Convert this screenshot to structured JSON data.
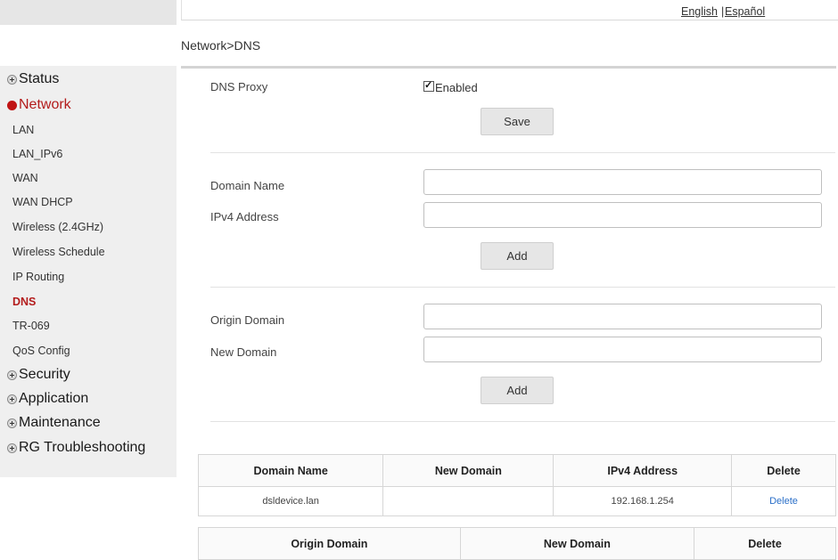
{
  "header": {
    "lang_english": "English",
    "lang_separator": "|",
    "lang_espanol": "Español",
    "breadcrumb": "Network>DNS"
  },
  "sidebar": {
    "sections": [
      {
        "label": "Status",
        "icon": "plus-circle-icon"
      },
      {
        "label": "Network",
        "icon": "red-dot-icon",
        "active": true
      },
      {
        "label": "Security",
        "icon": "plus-circle-icon"
      },
      {
        "label": "Application",
        "icon": "plus-circle-icon"
      },
      {
        "label": "Maintenance",
        "icon": "plus-circle-icon"
      },
      {
        "label": "RG Troubleshooting",
        "icon": "plus-circle-icon"
      }
    ],
    "network_items": [
      {
        "label": "LAN"
      },
      {
        "label": "LAN_IPv6"
      },
      {
        "label": "WAN"
      },
      {
        "label": "WAN DHCP"
      },
      {
        "label": "Wireless (2.4GHz)"
      },
      {
        "label": "Wireless Schedule"
      },
      {
        "label": "IP Routing"
      },
      {
        "label": "DNS",
        "active": true
      },
      {
        "label": "TR-069"
      },
      {
        "label": "QoS Config"
      }
    ]
  },
  "dns_proxy": {
    "label": "DNS Proxy",
    "checkbox_label": "Enabled",
    "checked": true,
    "save_label": "Save"
  },
  "host_form": {
    "domain_name_label": "Domain Name",
    "domain_name_value": "",
    "ipv4_label": "IPv4 Address",
    "ipv4_value": "",
    "add_label": "Add"
  },
  "rewrite_form": {
    "origin_domain_label": "Origin Domain",
    "origin_domain_value": "",
    "new_domain_label": "New Domain",
    "new_domain_value": "",
    "add_label": "Add"
  },
  "hosts_table": {
    "headers": [
      "Domain Name",
      "New Domain",
      "IPv4 Address",
      "Delete"
    ],
    "rows": [
      {
        "domain": "dsldevice.lan",
        "new_domain": "",
        "ipv4": "192.168.1.254",
        "delete": "Delete"
      }
    ]
  },
  "rewrite_table": {
    "headers": [
      "Origin Domain",
      "New Domain",
      "Delete"
    ]
  },
  "colors": {
    "active_nav": "#b31b1b",
    "link": "#2a6fc8",
    "sidebar_bg": "#efefef"
  }
}
